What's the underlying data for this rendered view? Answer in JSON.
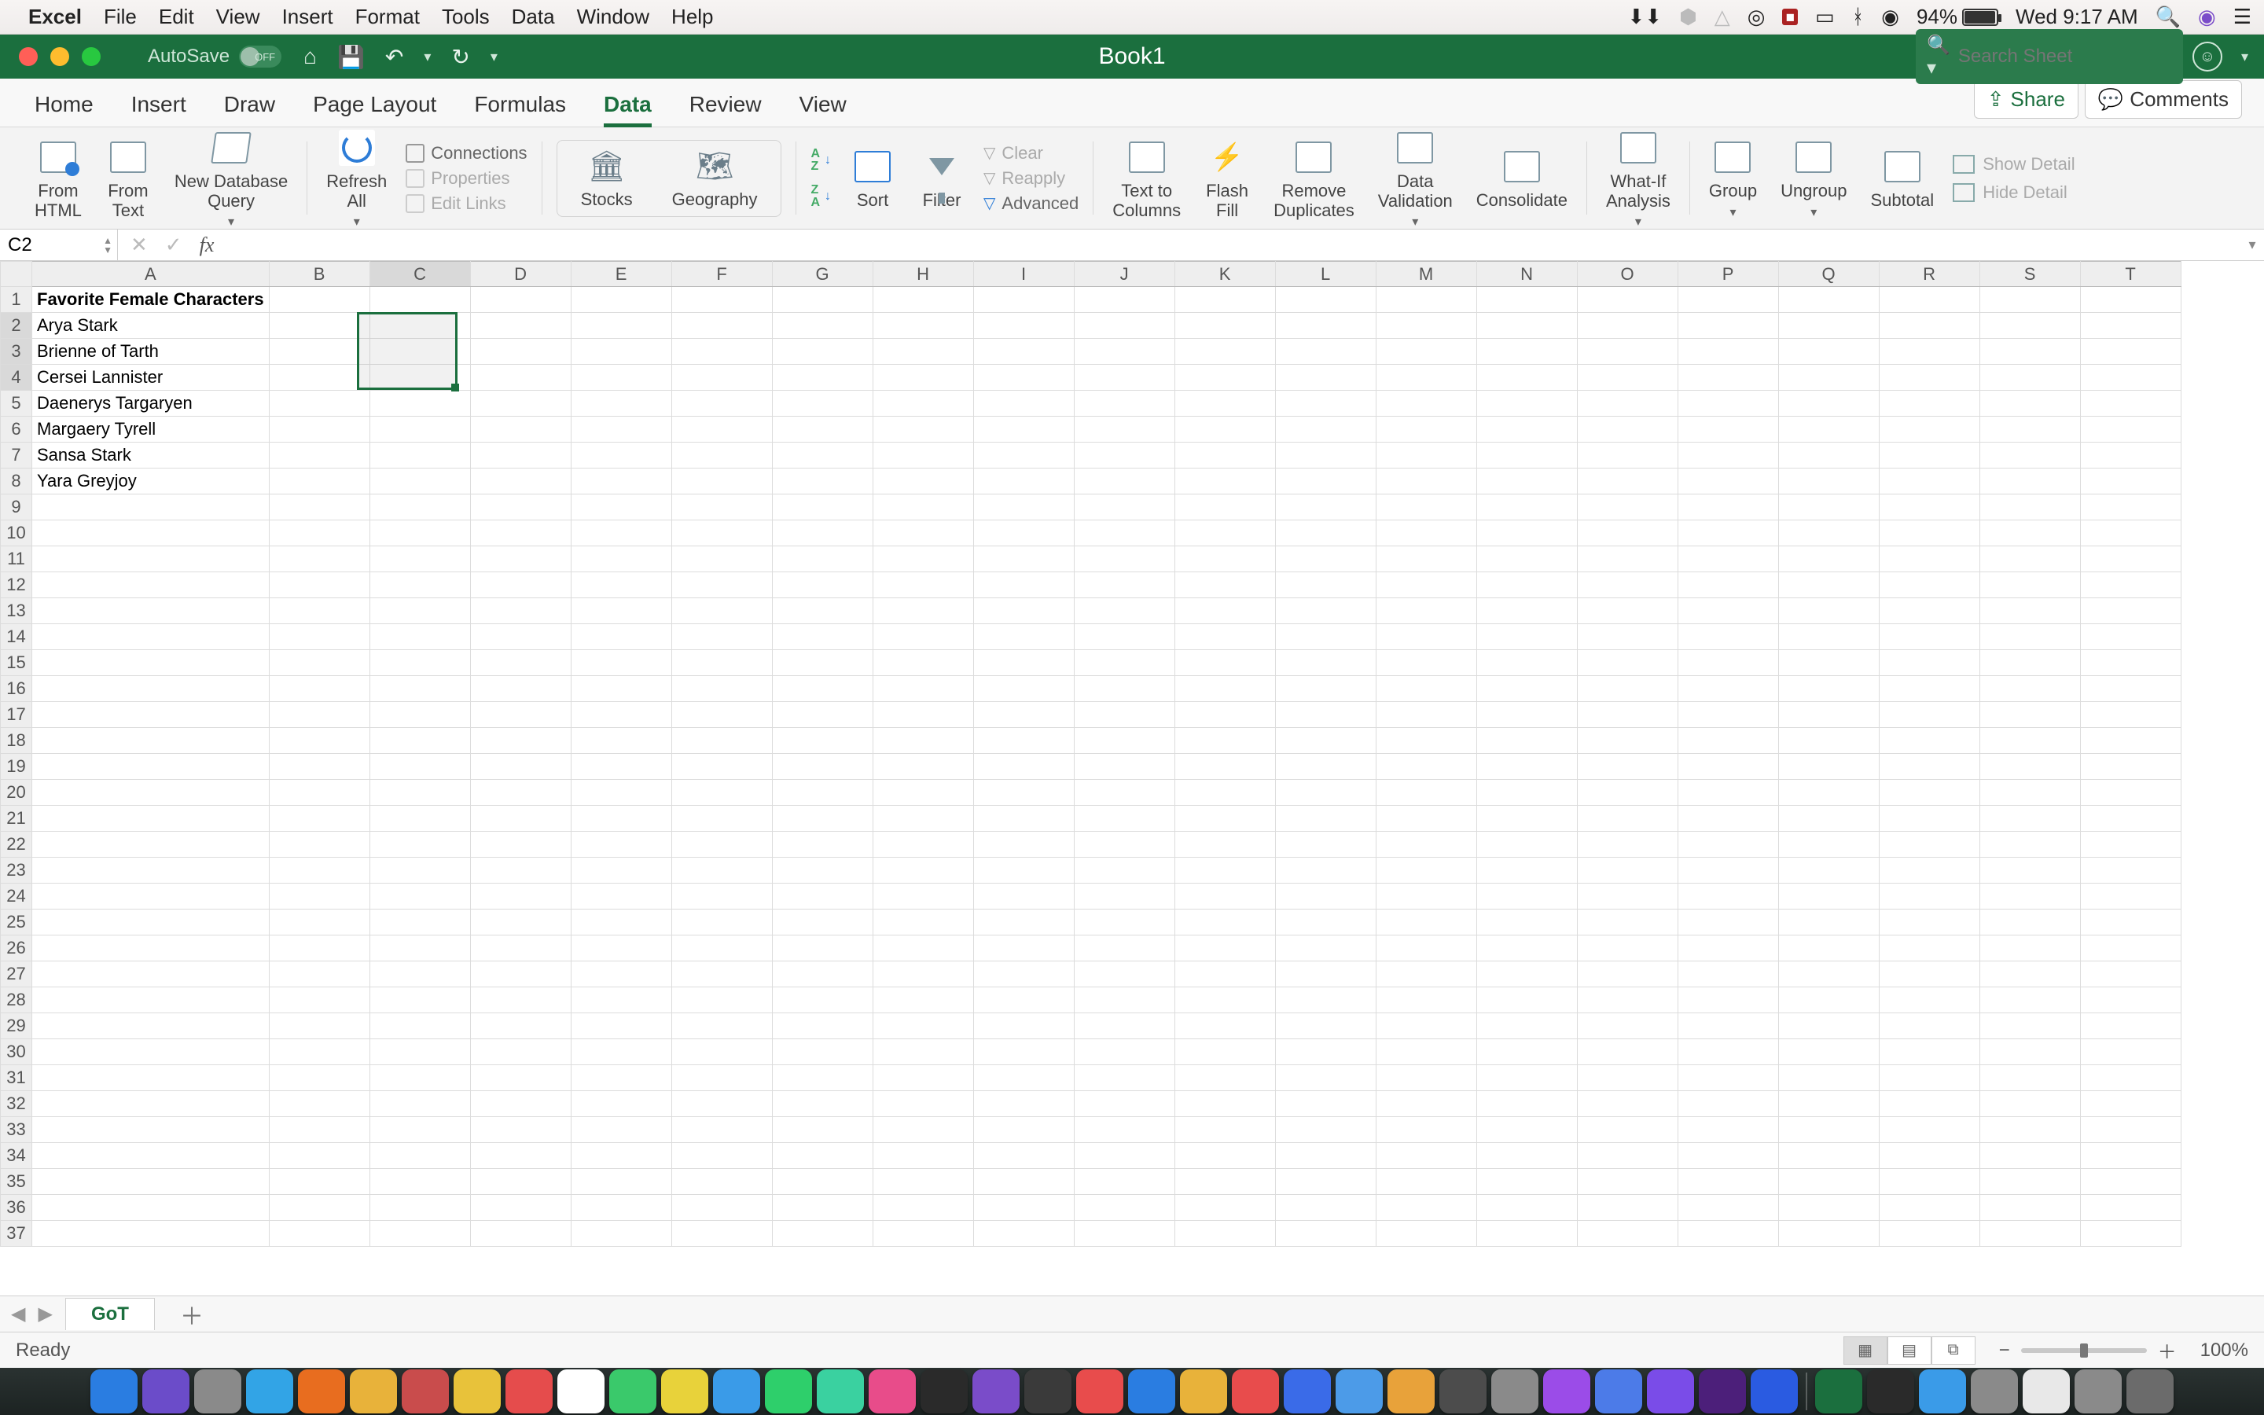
{
  "mac_menu": {
    "app": "Excel",
    "items": [
      "File",
      "Edit",
      "View",
      "Insert",
      "Format",
      "Tools",
      "Data",
      "Window",
      "Help"
    ],
    "battery_pct": "94%",
    "clock": "Wed 9:17 AM"
  },
  "titlebar": {
    "autosave_label": "AutoSave",
    "autosave_state": "OFF",
    "doc_title": "Book1",
    "search_placeholder": "Search Sheet"
  },
  "ribbon_tabs": {
    "tabs": [
      "Home",
      "Insert",
      "Draw",
      "Page Layout",
      "Formulas",
      "Data",
      "Review",
      "View"
    ],
    "active": "Data",
    "share": "Share",
    "comments": "Comments"
  },
  "ribbon": {
    "from_html": "From\nHTML",
    "from_text": "From\nText",
    "new_db_query": "New Database\nQuery",
    "refresh_all": "Refresh\nAll",
    "connections": "Connections",
    "properties": "Properties",
    "edit_links": "Edit Links",
    "stocks": "Stocks",
    "geography": "Geography",
    "sort": "Sort",
    "filter": "Filter",
    "clear": "Clear",
    "reapply": "Reapply",
    "advanced": "Advanced",
    "text_to_columns": "Text to\nColumns",
    "flash_fill": "Flash\nFill",
    "remove_duplicates": "Remove\nDuplicates",
    "data_validation": "Data\nValidation",
    "consolidate": "Consolidate",
    "whatif": "What-If\nAnalysis",
    "group": "Group",
    "ungroup": "Ungroup",
    "subtotal": "Subtotal",
    "show_detail": "Show Detail",
    "hide_detail": "Hide Detail"
  },
  "formula_bar": {
    "name_box": "C2",
    "formula": ""
  },
  "grid": {
    "columns": [
      "A",
      "B",
      "C",
      "D",
      "E",
      "F",
      "G",
      "H",
      "I",
      "J",
      "K",
      "L",
      "M",
      "N",
      "O",
      "P",
      "Q",
      "R",
      "S",
      "T"
    ],
    "row_count": 37,
    "selection": {
      "ref": "C2:C4",
      "colIndex": 2,
      "rowStart": 2,
      "rowEnd": 4
    },
    "cells": {
      "A1": {
        "v": "Favorite Female Characters",
        "bold": true
      },
      "A2": {
        "v": "Arya Stark"
      },
      "A3": {
        "v": "Brienne of Tarth"
      },
      "A4": {
        "v": "Cersei Lannister"
      },
      "A5": {
        "v": "Daenerys Targaryen"
      },
      "A6": {
        "v": "Margaery Tyrell"
      },
      "A7": {
        "v": "Sansa Stark"
      },
      "A8": {
        "v": "Yara Greyjoy"
      }
    }
  },
  "sheet_tabs": {
    "active": "GoT"
  },
  "statusbar": {
    "left": "Ready",
    "zoom": "100%"
  },
  "dock_apps": [
    "Finder",
    "Siri",
    "Launch",
    "Mail",
    "Books",
    "Cal-1",
    "Cal-2",
    "Notes",
    "Cal",
    "May22",
    "Msg",
    "Photos",
    "Msg2",
    "FaceT",
    "Maps",
    "iTunes",
    "Stocks",
    "TV",
    "Pod",
    "News",
    "Safari",
    "Chrome",
    "P",
    "W-b",
    "X",
    "O",
    "Sym",
    "Prefs",
    "V",
    "Teams",
    "Viber",
    "Slack",
    "Word",
    "Excel",
    "Br",
    "Folder",
    "Dl",
    "Pages",
    "Dl2",
    "Trash"
  ]
}
